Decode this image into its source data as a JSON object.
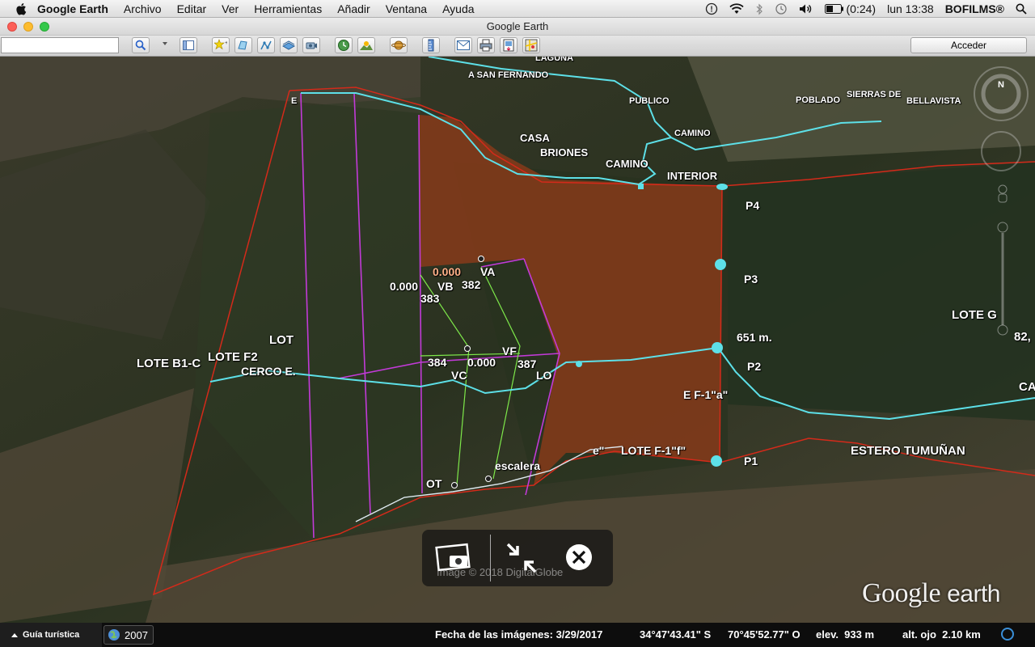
{
  "menubar": {
    "app_name": "Google Earth",
    "menus": [
      "Archivo",
      "Editar",
      "Ver",
      "Herramientas",
      "Añadir",
      "Ventana",
      "Ayuda"
    ],
    "battery": "(0:24)",
    "clock": "lun 13:38",
    "user": "BOFILMS®"
  },
  "window": {
    "title": "Google Earth"
  },
  "toolbar": {
    "search_value": "",
    "sign_in": "Acceder"
  },
  "map_labels": {
    "laguna": "LAGUNA",
    "a_san_fernando": "A SAN FERNANDO",
    "publico": "PUBLICO",
    "camino1": "CAMINO",
    "poblado": "POBLADO",
    "sierras": "SIERRAS DE",
    "bellavista": "BELLAVISTA",
    "casa": "CASA",
    "briones": "BRIONES",
    "camino2": "CAMINO",
    "interior": "INTERIOR",
    "p4": "P4",
    "p3": "P3",
    "p2": "P2",
    "p1": "P1",
    "lote_g": "LOTE G",
    "num_82": "82,",
    "ca": "CA",
    "dist_651": "651 m.",
    "lote_f1a": "E F-1\"a\"",
    "estero": "ESTERO TUMUÑAN",
    "lote_f1f": "LOTE F-1\"f\"",
    "e_quote": "e\"",
    "escalera": "escalera",
    "ot": "OT",
    "lo": "LO",
    "e_top": "E",
    "lot": "LOT",
    "lote_b1": "LOTE B1-C",
    "lote_f2": "LOTE F2",
    "cerco": "CERCO E.",
    "va_val": "0.000",
    "va": "VA",
    "va_num": "382",
    "vb_val": "0.000",
    "vb": "VB",
    "vb_num": "383",
    "vf": "VF",
    "vc_num": "384",
    "vc_val": "0.000",
    "vc": "VC",
    "vf_num": "387"
  },
  "tour_panel": {
    "copyright": "Image © 2018 DigitalGlobe"
  },
  "watermark": {
    "text1": "Google",
    "text2": "earth"
  },
  "statusbar": {
    "tour_guide": "Guía turística",
    "year": "2007",
    "imagery_date": "Fecha de las imágenes: 3/29/2017",
    "lat": "34°47'43.41\" S",
    "lon": "70°45'52.77\" O",
    "elev": "elev.  933 m",
    "eye_alt": "alt. ojo  2.10 km"
  },
  "icons": [
    "apple-icon",
    "search-icon",
    "sidebar-icon",
    "placemark-icon",
    "polygon-icon",
    "path-icon",
    "overlay-icon",
    "tour-icon",
    "history-icon",
    "sun-icon",
    "planets-icon",
    "ruler-icon",
    "email-icon",
    "print-icon",
    "save-image-icon",
    "maps-icon",
    "camera-icon",
    "exit-fullscreen-icon",
    "close-icon",
    "compass-icon",
    "globe-icon"
  ]
}
